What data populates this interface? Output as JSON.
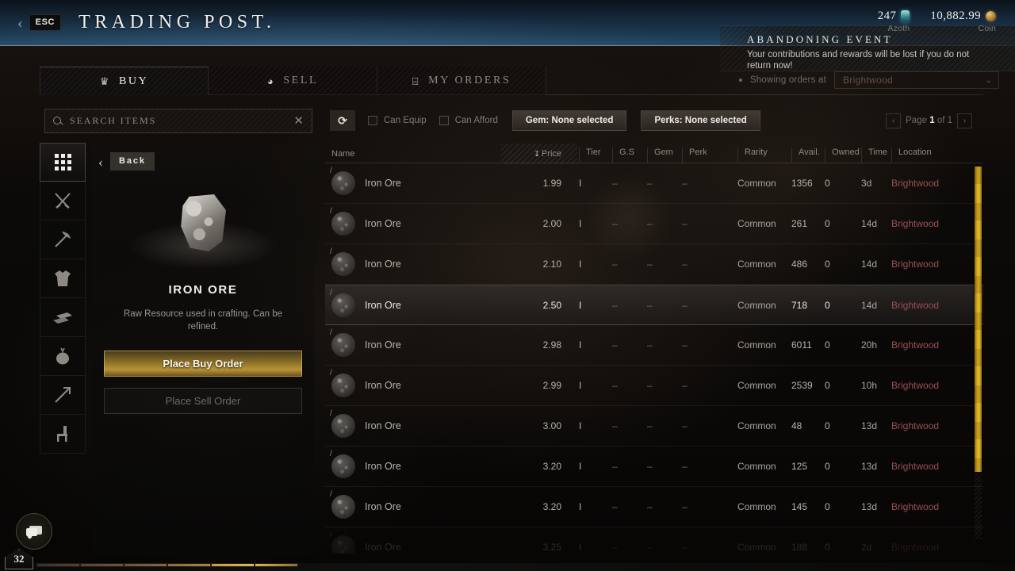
{
  "header": {
    "esc_label": "ESC",
    "back_chevron": "‹",
    "title": "Trading Post."
  },
  "currency": {
    "azoth": {
      "value": "247",
      "label": "Azoth",
      "icon": "azoth-crystal-icon"
    },
    "coin": {
      "value": "10,882.99",
      "label": "Coin",
      "icon": "coin-icon"
    }
  },
  "event_toast": {
    "title": "Abandoning Event",
    "message": "Your contributions and rewards will be lost if you do not return now!"
  },
  "showing_orders": {
    "label": "Showing orders at",
    "territory": "Brightwood",
    "caret": "⌄"
  },
  "tabs": [
    {
      "label": "Buy",
      "icon": "crown-icon",
      "glyph": "♛",
      "active": true
    },
    {
      "label": "Sell",
      "icon": "coins-stack-icon",
      "glyph": "◕",
      "active": false
    },
    {
      "label": "My Orders",
      "icon": "ledger-icon",
      "glyph": "⌸",
      "active": false
    }
  ],
  "search": {
    "placeholder": "Search Items",
    "value": "",
    "clear_label": "✕",
    "icon": "search-icon"
  },
  "filters": {
    "refresh_label": "⟳",
    "can_equip": {
      "label": "Can Equip",
      "checked": false
    },
    "can_afford": {
      "label": "Can Afford",
      "checked": false
    },
    "gem": "Gem: None selected",
    "perks": "Perks: None selected"
  },
  "pagination": {
    "prev": "‹",
    "next": "›",
    "page_word": "Page",
    "current": "1",
    "of_text": "of 1"
  },
  "categories": [
    {
      "name": "category-all",
      "glyph": "grid",
      "active": true
    },
    {
      "name": "category-weapons",
      "glyph": "⚔",
      "active": false
    },
    {
      "name": "category-tools",
      "glyph": "⛏",
      "active": false
    },
    {
      "name": "category-armor",
      "glyph": "ὅ5",
      "active": false
    },
    {
      "name": "category-resources",
      "glyph": "▰",
      "active": false
    },
    {
      "name": "category-consumables",
      "glyph": "◖",
      "active": false
    },
    {
      "name": "category-ammunition",
      "glyph": "↗",
      "active": false
    },
    {
      "name": "category-furniture",
      "glyph": "⚏",
      "active": false
    }
  ],
  "detail": {
    "back_label": "Back",
    "back_arrow": "‹",
    "item_name": "IRON ORE",
    "item_description": "Raw Resource used in crafting. Can be refined.",
    "buy_button": "Place Buy Order",
    "sell_button": "Place Sell Order"
  },
  "table": {
    "columns": [
      "Name",
      "Price",
      "Tier",
      "G.S",
      "Gem",
      "Perk",
      "Rarity",
      "Avail.",
      "Owned",
      "Time",
      "Location"
    ],
    "sort_column": "Price",
    "sort_caret": "↧",
    "rows": [
      {
        "name": "Iron Ore",
        "price": "1.99",
        "tier": "I",
        "gs": "–",
        "gem": "–",
        "perk": "–",
        "rarity": "Common",
        "avail": "1356",
        "owned": "0",
        "time": "3d",
        "location": "Brightwood",
        "selected": false
      },
      {
        "name": "Iron Ore",
        "price": "2.00",
        "tier": "I",
        "gs": "–",
        "gem": "–",
        "perk": "–",
        "rarity": "Common",
        "avail": "261",
        "owned": "0",
        "time": "14d",
        "location": "Brightwood",
        "selected": false
      },
      {
        "name": "Iron Ore",
        "price": "2.10",
        "tier": "I",
        "gs": "–",
        "gem": "–",
        "perk": "–",
        "rarity": "Common",
        "avail": "486",
        "owned": "0",
        "time": "14d",
        "location": "Brightwood",
        "selected": false
      },
      {
        "name": "Iron Ore",
        "price": "2.50",
        "tier": "I",
        "gs": "–",
        "gem": "–",
        "perk": "–",
        "rarity": "Common",
        "avail": "718",
        "owned": "0",
        "time": "14d",
        "location": "Brightwood",
        "selected": true
      },
      {
        "name": "Iron Ore",
        "price": "2.98",
        "tier": "I",
        "gs": "–",
        "gem": "–",
        "perk": "–",
        "rarity": "Common",
        "avail": "6011",
        "owned": "0",
        "time": "20h",
        "location": "Brightwood",
        "selected": false
      },
      {
        "name": "Iron Ore",
        "price": "2.99",
        "tier": "I",
        "gs": "–",
        "gem": "–",
        "perk": "–",
        "rarity": "Common",
        "avail": "2539",
        "owned": "0",
        "time": "10h",
        "location": "Brightwood",
        "selected": false
      },
      {
        "name": "Iron Ore",
        "price": "3.00",
        "tier": "I",
        "gs": "–",
        "gem": "–",
        "perk": "–",
        "rarity": "Common",
        "avail": "48",
        "owned": "0",
        "time": "13d",
        "location": "Brightwood",
        "selected": false
      },
      {
        "name": "Iron Ore",
        "price": "3.20",
        "tier": "I",
        "gs": "–",
        "gem": "–",
        "perk": "–",
        "rarity": "Common",
        "avail": "125",
        "owned": "0",
        "time": "13d",
        "location": "Brightwood",
        "selected": false
      },
      {
        "name": "Iron Ore",
        "price": "3.20",
        "tier": "I",
        "gs": "–",
        "gem": "–",
        "perk": "–",
        "rarity": "Common",
        "avail": "145",
        "owned": "0",
        "time": "13d",
        "location": "Brightwood",
        "selected": false
      },
      {
        "name": "Iron Ore",
        "price": "3.25",
        "tier": "I",
        "gs": "–",
        "gem": "–",
        "perk": "–",
        "rarity": "Common",
        "avail": "188",
        "owned": "0",
        "time": "2d",
        "location": "Brightwood",
        "selected": false
      }
    ]
  },
  "hud": {
    "chat_icon": "chat-bubbles-icon",
    "level": "32"
  },
  "colors": {
    "accent_gold": "#b89336",
    "scrollbar_gold": "#d6a81c",
    "location_red": "#9a4f52",
    "header_blue": "#1c3a52"
  }
}
